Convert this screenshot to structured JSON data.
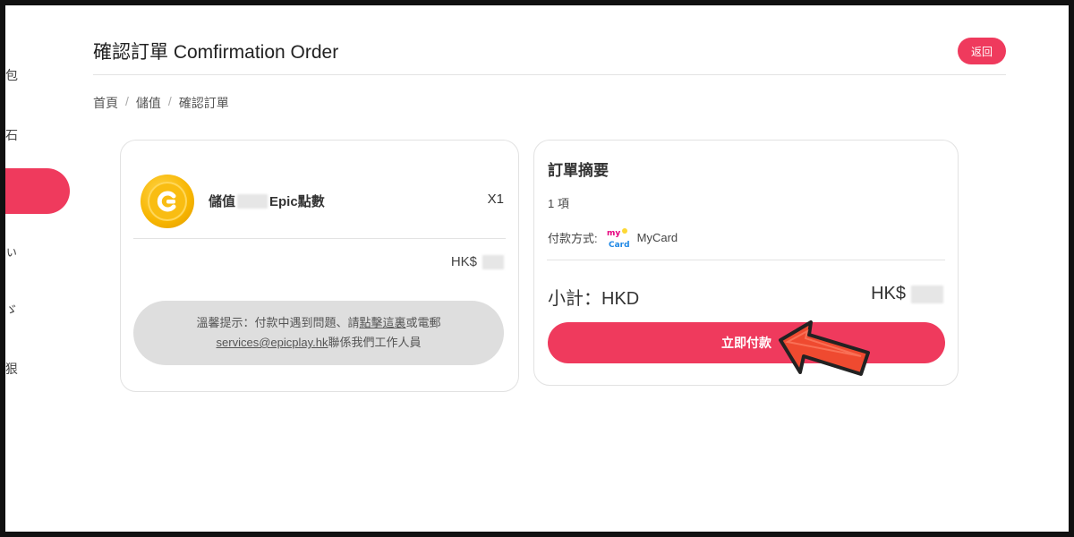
{
  "sidebar": {
    "fragments": [
      "包",
      "石",
      "ぃ",
      "ゞ",
      "狠"
    ]
  },
  "header": {
    "title": "確認訂單 Comfirmation Order",
    "back_label": "返回"
  },
  "breadcrumb": [
    "首頁",
    "儲值",
    "確認訂單"
  ],
  "breadcrumb_sep": "/",
  "order_item": {
    "name_prefix": "儲值",
    "name_suffix": "Epic點數",
    "quantity": "X1",
    "price_currency": "HK$"
  },
  "notice": {
    "line1_prefix": "溫馨提示：付款中遇到問題、請",
    "line1_link": "點擊這裏",
    "line1_suffix": "或電郵",
    "email": "services@epicplay.hk",
    "line2_suffix": "聯係我們工作人員"
  },
  "summary": {
    "title": "訂單摘要",
    "item_count": "1 項",
    "payment_label": "付款方式:",
    "payment_method": "MyCard",
    "subtotal_label": "小計：HKD",
    "subtotal_currency": "HK$",
    "pay_button": "立即付款"
  },
  "colors": {
    "accent": "#ef3a5d",
    "notice_bg": "#dedede",
    "arrow": "#ef4a30"
  }
}
